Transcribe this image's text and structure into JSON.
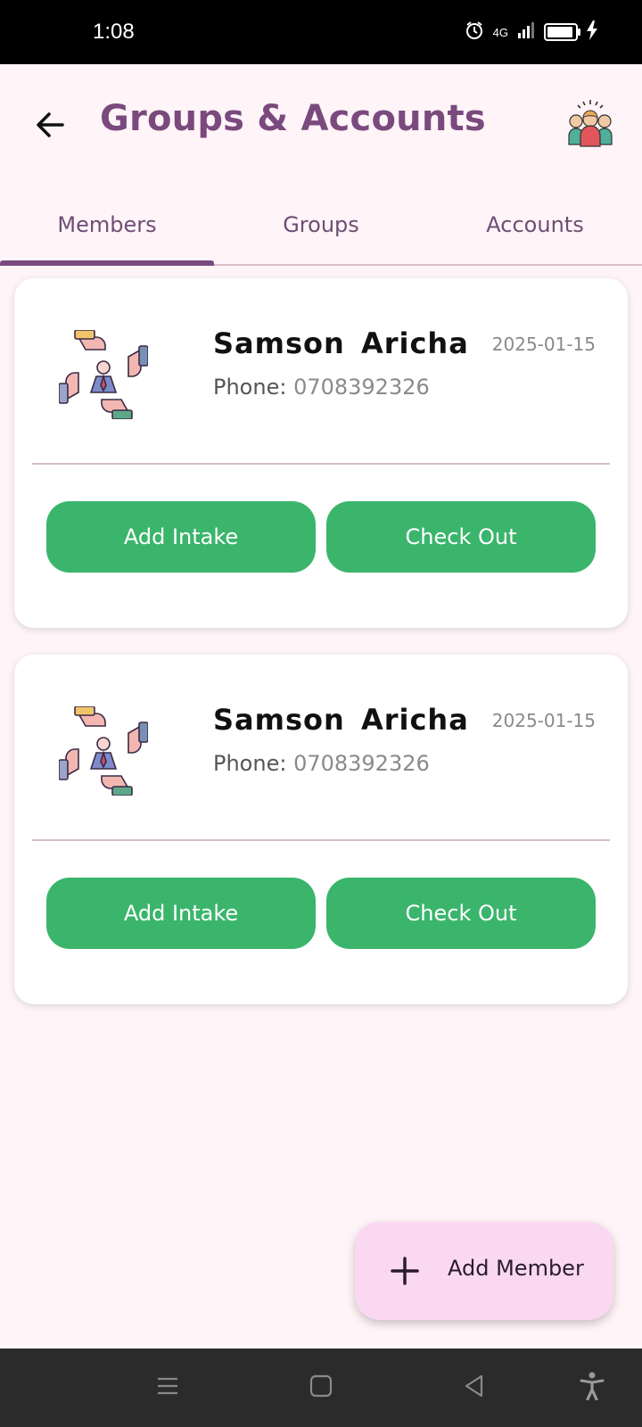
{
  "status_bar": {
    "time": "1:08",
    "network": "4G",
    "icons": [
      "alarm-icon",
      "signal-icon",
      "battery-icon",
      "charging-icon"
    ]
  },
  "header": {
    "title": "Groups & Accounts",
    "back_icon": "arrow-back-icon",
    "action_icon": "team-icon"
  },
  "tabs": [
    {
      "label": "Members",
      "selected": true
    },
    {
      "label": "Groups",
      "selected": false
    },
    {
      "label": "Accounts",
      "selected": false
    }
  ],
  "members": [
    {
      "name": "Samson  Aricha",
      "date": "2025-01-15",
      "phone_label": "Phone: ",
      "phone": "0708392326",
      "intake_label": "Add Intake",
      "checkout_label": "Check Out"
    },
    {
      "name": "Samson  Aricha",
      "date": "2025-01-15",
      "phone_label": "Phone: ",
      "phone": "0708392326",
      "intake_label": "Add Intake",
      "checkout_label": "Check Out"
    }
  ],
  "fab": {
    "label": "Add Member",
    "icon": "plus-icon"
  },
  "colors": {
    "background": "#FFF4F7",
    "title": "#7A4A7E",
    "button_green": "#3BB56C",
    "fab": "#FAD8F2"
  }
}
